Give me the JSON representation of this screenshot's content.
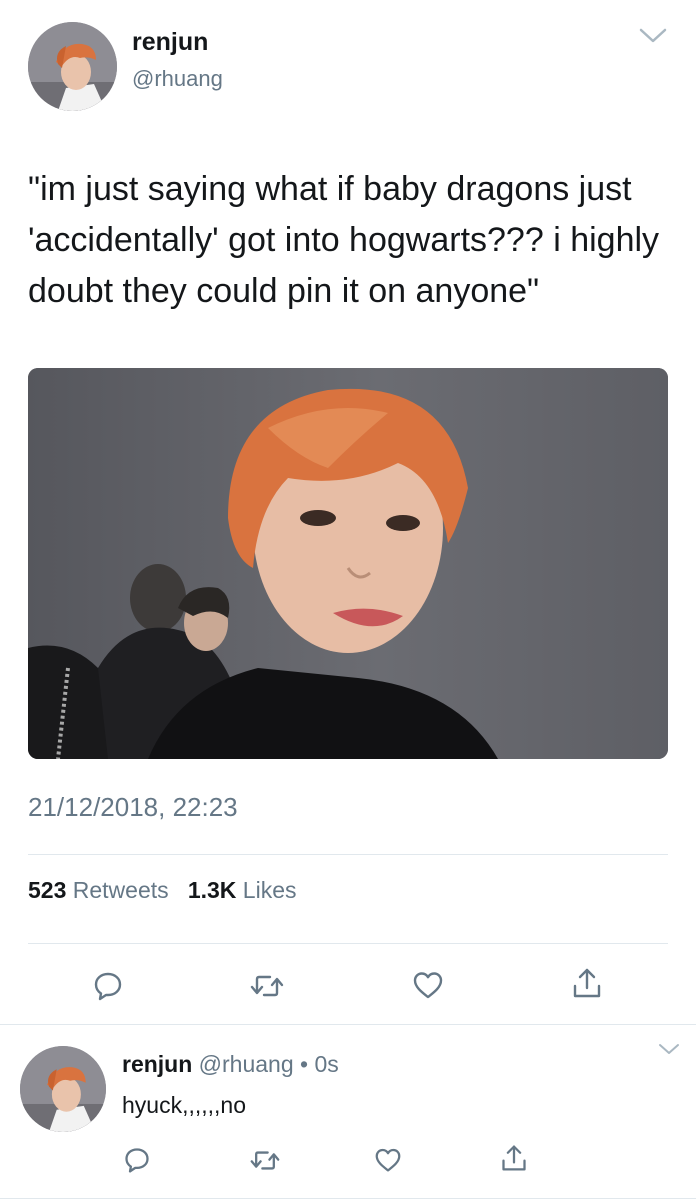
{
  "tweet": {
    "display_name": "renjun",
    "handle": "@rhuang",
    "text": "\"im just saying what if baby dragons just 'accidentally' got into hogwarts??? i highly doubt they could pin it on anyone\"",
    "timestamp": "21/12/2018, 22:23",
    "stats": {
      "retweets_count": "523",
      "retweets_label": "Retweets",
      "likes_count": "1.3K",
      "likes_label": "Likes"
    }
  },
  "actions": {
    "icons": [
      "reply-icon",
      "retweet-icon",
      "like-icon",
      "share-icon"
    ]
  },
  "reply": {
    "display_name": "renjun",
    "handle": "@rhuang",
    "separator": "•",
    "time": "0s",
    "text": "hyuck,,,,,,no"
  },
  "colors": {
    "text_primary": "#14171a",
    "text_secondary": "#657786",
    "divider": "#e1e8ed",
    "hair": "#d9733f"
  }
}
